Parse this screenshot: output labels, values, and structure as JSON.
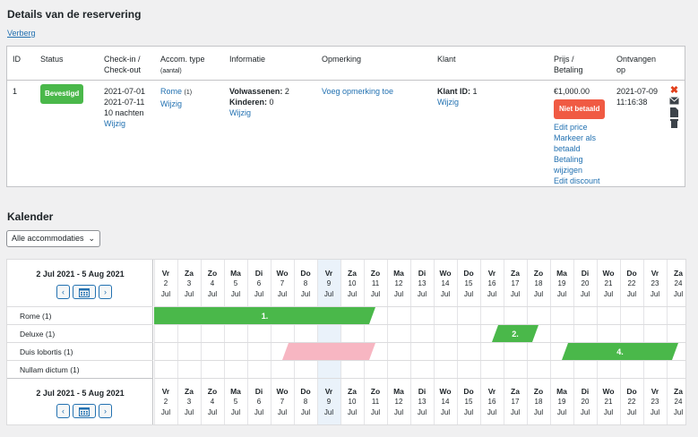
{
  "details": {
    "title": "Details van de reservering",
    "hide_link": "Verberg",
    "headers": {
      "id": "ID",
      "status": "Status",
      "checkin_1": "Check-in /",
      "checkin_2": "Check-out",
      "accom_1": "Accom. type",
      "accom_2": "(aantal)",
      "info": "Informatie",
      "note": "Opmerking",
      "client": "Klant",
      "price_1": "Prijs /",
      "price_2": "Betaling",
      "received_1": "Ontvangen",
      "received_2": "op"
    },
    "row": {
      "id": "1",
      "status": "Bevestigd",
      "checkin": "2021-07-01",
      "checkout": "2021-07-11",
      "nights": "10 nachten",
      "dates_edit": "Wijzig",
      "accom_name": "Rome",
      "accom_count": "(1)",
      "accom_edit": "Wijzig",
      "adults_label": "Volwassenen:",
      "adults": "2",
      "children_label": "Kinderen:",
      "children": "0",
      "info_edit": "Wijzig",
      "add_note": "Voeg opmerking toe",
      "client_label": "Klant ID:",
      "client_id": "1",
      "client_edit": "Wijzig",
      "price": "€1,000.00",
      "payment_status": "Niet betaald",
      "edit_price": "Edit price",
      "mark_paid_1": "Markeer als",
      "mark_paid_2": "betaald",
      "payment_change_1": "Betaling",
      "payment_change_2": "wijzigen",
      "edit_discount": "Edit discount",
      "received_date": "2021-07-09",
      "received_time": "11:16:38"
    },
    "actions": [
      "delete-icon",
      "email-icon",
      "document-icon",
      "trash-icon"
    ]
  },
  "calendar": {
    "title": "Kalender",
    "filter": "Alle accommodaties",
    "range": "2 Jul 2021 - 5 Aug 2021",
    "prev": "‹",
    "next": "›",
    "rooms": [
      "Rome (1)",
      "Deluxe (1)",
      "Duis lobortis (1)",
      "Nullam dictum (1)"
    ],
    "days": [
      {
        "wd": "Vr",
        "d": "2",
        "m": "Jul"
      },
      {
        "wd": "Za",
        "d": "3",
        "m": "Jul"
      },
      {
        "wd": "Zo",
        "d": "4",
        "m": "Jul"
      },
      {
        "wd": "Ma",
        "d": "5",
        "m": "Jul"
      },
      {
        "wd": "Di",
        "d": "6",
        "m": "Jul"
      },
      {
        "wd": "Wo",
        "d": "7",
        "m": "Jul"
      },
      {
        "wd": "Do",
        "d": "8",
        "m": "Jul"
      },
      {
        "wd": "Vr",
        "d": "9",
        "m": "Jul"
      },
      {
        "wd": "Za",
        "d": "10",
        "m": "Jul"
      },
      {
        "wd": "Zo",
        "d": "11",
        "m": "Jul"
      },
      {
        "wd": "Ma",
        "d": "12",
        "m": "Jul"
      },
      {
        "wd": "Di",
        "d": "13",
        "m": "Jul"
      },
      {
        "wd": "Wo",
        "d": "14",
        "m": "Jul"
      },
      {
        "wd": "Do",
        "d": "15",
        "m": "Jul"
      },
      {
        "wd": "Vr",
        "d": "16",
        "m": "Jul"
      },
      {
        "wd": "Za",
        "d": "17",
        "m": "Jul"
      },
      {
        "wd": "Zo",
        "d": "18",
        "m": "Jul"
      },
      {
        "wd": "Ma",
        "d": "19",
        "m": "Jul"
      },
      {
        "wd": "Di",
        "d": "20",
        "m": "Jul"
      },
      {
        "wd": "Wo",
        "d": "21",
        "m": "Jul"
      },
      {
        "wd": "Do",
        "d": "22",
        "m": "Jul"
      },
      {
        "wd": "Vr",
        "d": "23",
        "m": "Jul"
      },
      {
        "wd": "Za",
        "d": "24",
        "m": "Jul"
      }
    ],
    "today_day": "9",
    "bookings": [
      {
        "label": "1.",
        "room": "Rome (1)",
        "from": "2",
        "to": "11",
        "color": "#4ab84a"
      },
      {
        "label": "2.",
        "room": "Deluxe (1)",
        "from": "16",
        "to": "18",
        "color": "#4ab84a"
      },
      {
        "label": "",
        "room": "Duis lobortis (1)",
        "from": "7",
        "to": "11",
        "color": "#f7b6c2"
      },
      {
        "label": "4.",
        "room": "Duis lobortis (1)",
        "from": "19",
        "to": "24",
        "color": "#4ab84a"
      }
    ]
  }
}
